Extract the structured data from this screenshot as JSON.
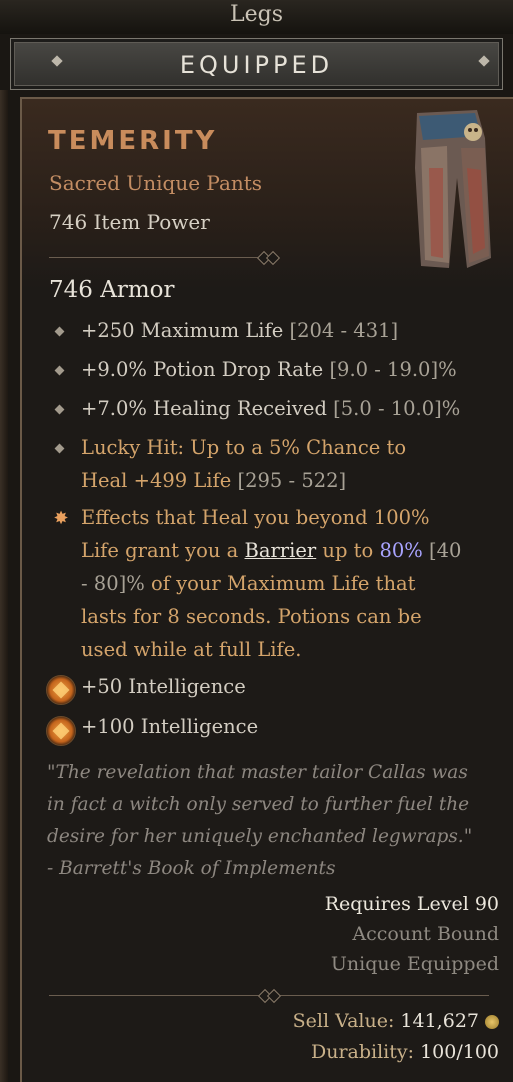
{
  "top": {
    "label": "Legs"
  },
  "header": {
    "title": "EQUIPPED"
  },
  "item": {
    "name": "TEMERITY",
    "type": "Sacred Unique Pants",
    "power": "746 Item Power",
    "armor": "746 Armor",
    "image_icon": "pants-icon"
  },
  "affixes": [
    {
      "value": "+250 Maximum Life",
      "range": "[204 - 431]"
    },
    {
      "value": "+9.0% Potion Drop Rate",
      "range": "[9.0 - 19.0]%"
    },
    {
      "value": "+7.0% Healing Received",
      "range": "[5.0 - 10.0]%"
    },
    {
      "value": "Lucky Hit: Up to a 5% Chance to",
      "line2": "Heal +499 Life",
      "range": "[295 - 522]"
    }
  ],
  "legendary": {
    "line1": "Effects that Heal you beyond 100%",
    "line2_pre": "Life grant you a ",
    "line2_link": "Barrier",
    "line2_mid": " up to ",
    "line2_value": "80%",
    "line2_range": " [40",
    "line3_range": "- 80]%",
    "line3_rest": " of your Maximum Life that",
    "line4": "lasts for 8 seconds. Potions can be",
    "line5": "used while at full Life."
  },
  "sockets": [
    {
      "label": "+50 Intelligence",
      "icon": "amber-gem-icon"
    },
    {
      "label": "+100 Intelligence",
      "icon": "amber-gem-icon"
    }
  ],
  "flavor": {
    "l1": "\"The revelation that master tailor Callas was",
    "l2": "in fact a witch only served to further fuel the",
    "l3": "desire for her uniquely enchanted legwraps.\"",
    "l4": "- Barrett's Book of Implements"
  },
  "requirements": {
    "level": "Requires Level 90",
    "bound": "Account Bound",
    "unique": "Unique Equipped"
  },
  "footer": {
    "sell_label": "Sell Value:",
    "sell_value": "141,627",
    "durability_label": "Durability:",
    "durability_value": "100/100"
  },
  "colors": {
    "unique": "#c98c5c",
    "legendary": "#d4a46b",
    "barrier_value": "#a9a4ff"
  }
}
